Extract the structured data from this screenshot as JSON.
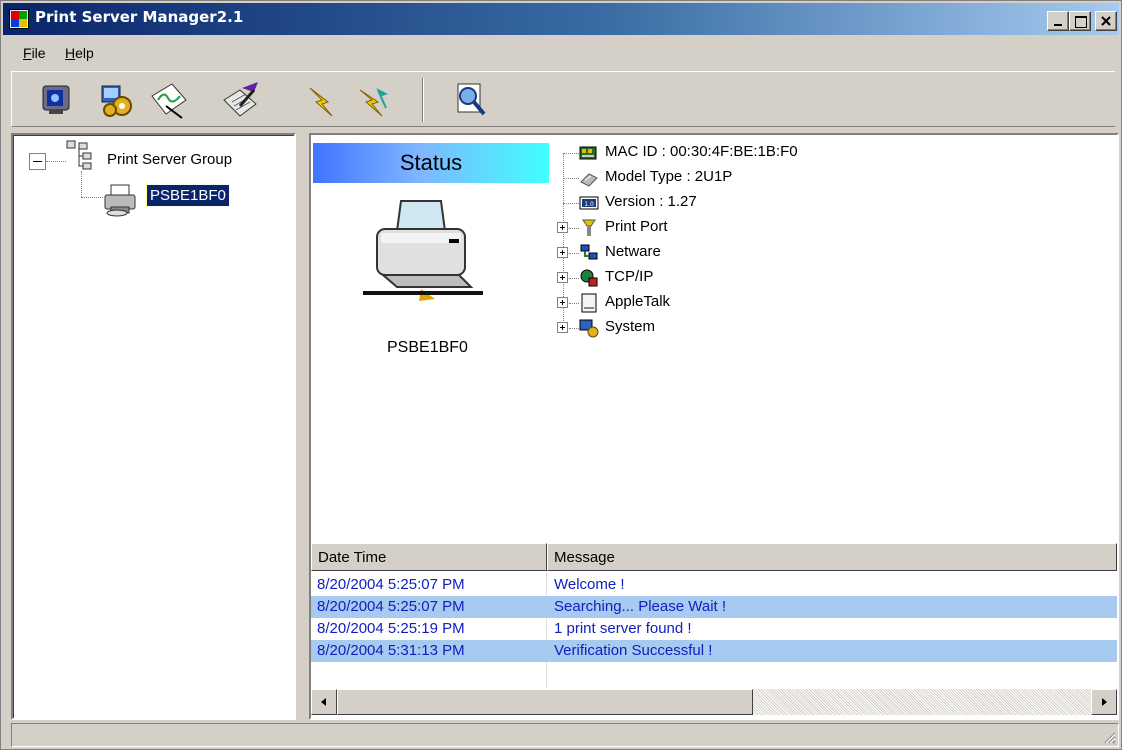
{
  "window": {
    "title": "Print Server Manager2.1"
  },
  "menu": {
    "file": {
      "underline": "F",
      "rest": "ile"
    },
    "help": {
      "underline": "H",
      "rest": "elp"
    }
  },
  "toolbar": {
    "buttons": [
      {
        "icon": "monitor-icon"
      },
      {
        "icon": "settings-gear-icon"
      },
      {
        "icon": "graph-document-icon"
      },
      {
        "icon": "edit-notepad-icon"
      },
      {
        "icon": "lightning-icon"
      },
      {
        "icon": "lightning-arrow-icon"
      },
      {
        "icon": "search-document-icon"
      }
    ]
  },
  "tree": {
    "root_label": "Print Server Group",
    "child_label": "PSBE1BF0"
  },
  "status": {
    "banner": "Status",
    "printer_name": "PSBE1BF0",
    "properties": [
      {
        "label": "MAC ID : 00:30:4F:BE:1B:F0",
        "icon": "network-card-icon",
        "expandable": false
      },
      {
        "label": "Model Type : 2U1P",
        "icon": "model-icon",
        "expandable": false
      },
      {
        "label": "Version : 1.27",
        "icon": "version-icon",
        "expandable": false
      },
      {
        "label": "Print Port",
        "icon": "print-port-icon",
        "expandable": true
      },
      {
        "label": "Netware",
        "icon": "netware-icon",
        "expandable": true
      },
      {
        "label": "TCP/IP",
        "icon": "tcpip-icon",
        "expandable": true
      },
      {
        "label": "AppleTalk",
        "icon": "appletalk-icon",
        "expandable": true
      },
      {
        "label": "System",
        "icon": "system-icon",
        "expandable": true
      }
    ]
  },
  "log": {
    "columns": [
      "Date Time",
      "Message"
    ],
    "rows": [
      {
        "datetime": "8/20/2004 5:25:07 PM",
        "message": "Welcome !"
      },
      {
        "datetime": "8/20/2004 5:25:07 PM",
        "message": "Searching... Please Wait !"
      },
      {
        "datetime": "8/20/2004 5:25:19 PM",
        "message": "1 print server found !"
      },
      {
        "datetime": "8/20/2004 5:31:13 PM",
        "message": "Verification Successful !"
      }
    ]
  },
  "colors": {
    "title_start": "#0a246a",
    "title_end": "#a6caf0",
    "selection": "#0a246a",
    "log_text": "#1020c0",
    "log_alt_row": "#a6caf0",
    "chrome": "#d4d0c8"
  }
}
